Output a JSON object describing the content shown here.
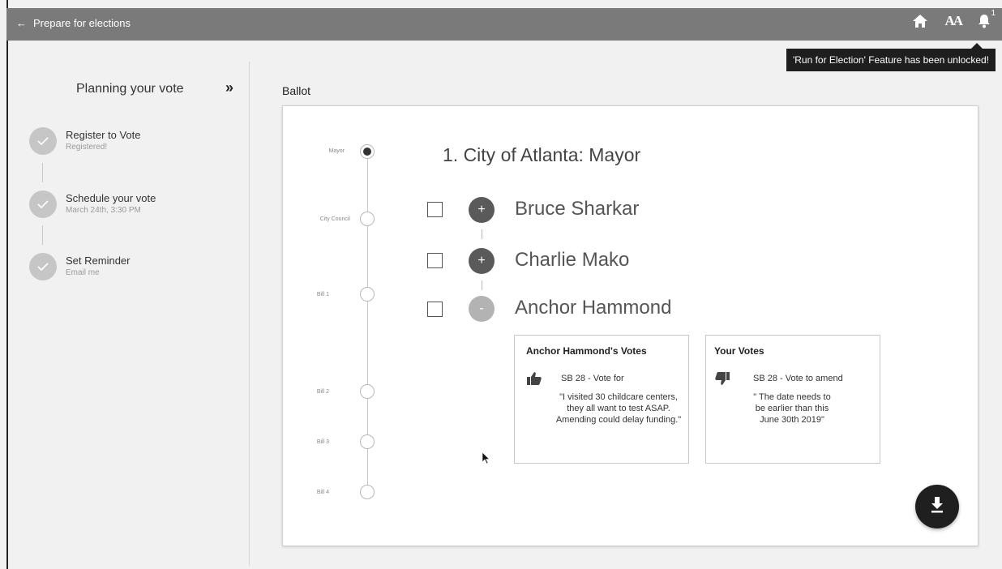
{
  "header": {
    "back_label": "Prepare for elections",
    "notification_count": "1",
    "tooltip": "'Run for Election' Feature has been unlocked!"
  },
  "planning": {
    "title": "Planning your vote",
    "steps": [
      {
        "title": "Register to Vote",
        "subtitle": "Registered!"
      },
      {
        "title": "Schedule your vote",
        "subtitle": "March 24th, 3:30 PM"
      },
      {
        "title": "Set Reminder",
        "subtitle": "Email me"
      }
    ]
  },
  "ballot": {
    "label": "Ballot",
    "timeline": [
      "Mayor",
      "City Council",
      "Bill 1",
      "Bill 2",
      "Bill 3",
      "Bill 4"
    ],
    "race_title": "1. City of Atlanta: Mayor",
    "candidates": [
      {
        "name": "Bruce Sharkar",
        "toggle": "+"
      },
      {
        "name": "Charlie Mako",
        "toggle": "+"
      },
      {
        "name": "Anchor Hammond",
        "toggle": "-"
      }
    ],
    "candidate_votes": {
      "title": "Anchor Hammond's Votes",
      "bill": "SB 28 - Vote for",
      "quote": "\"I visited 30 childcare centers, they all want to test ASAP. Amending could delay funding.\""
    },
    "your_votes": {
      "title": "Your Votes",
      "bill": "SB 28 - Vote to amend",
      "quote": "\" The date needs to be earlier than this June 30th 2019\""
    }
  }
}
